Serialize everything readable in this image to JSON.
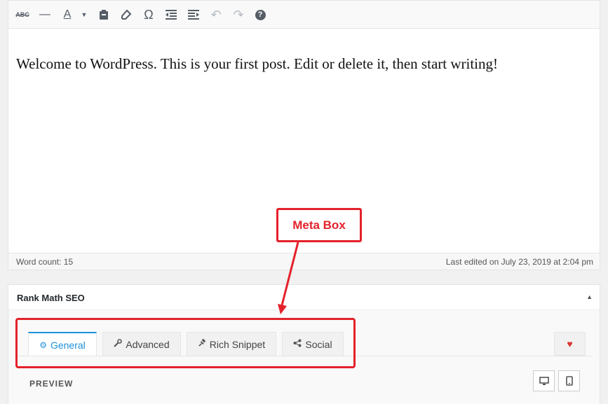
{
  "toolbar": {
    "buttons": [
      {
        "name": "strikethrough-icon",
        "glyph": "ABC"
      },
      {
        "name": "horizontal-line-icon",
        "glyph": "—"
      },
      {
        "name": "text-color-icon",
        "glyph": "A"
      },
      {
        "name": "paste-text-icon",
        "glyph": ""
      },
      {
        "name": "clear-formatting-icon",
        "glyph": ""
      },
      {
        "name": "special-character-icon",
        "glyph": "Ω"
      },
      {
        "name": "outdent-icon",
        "glyph": ""
      },
      {
        "name": "indent-icon",
        "glyph": ""
      },
      {
        "name": "undo-icon",
        "glyph": "↶"
      },
      {
        "name": "redo-icon",
        "glyph": "↷"
      },
      {
        "name": "help-icon",
        "glyph": "?"
      }
    ]
  },
  "editor": {
    "content": "Welcome to WordPress. This is your first post. Edit or delete it, then start writing!",
    "word_count": "Word count: 15",
    "last_edited": "Last edited on July 23, 2019 at 2:04 pm"
  },
  "metabox": {
    "title": "Rank Math SEO",
    "toggle_glyph": "▲",
    "tabs": [
      {
        "label": "General",
        "icon": "gear-icon",
        "glyph": "⚙"
      },
      {
        "label": "Advanced",
        "icon": "wrench-icon",
        "glyph": "🔧"
      },
      {
        "label": "Rich Snippet",
        "icon": "pin-icon",
        "glyph": "📌"
      },
      {
        "label": "Social",
        "icon": "share-icon",
        "glyph": "⋖"
      }
    ],
    "heart_glyph": "♥",
    "preview_label": "PREVIEW"
  },
  "annotation": {
    "label": "Meta Box"
  },
  "colors": {
    "annotation": "#e4212b",
    "active_tab": "#1d8fd8",
    "heart": "#dd3333"
  }
}
